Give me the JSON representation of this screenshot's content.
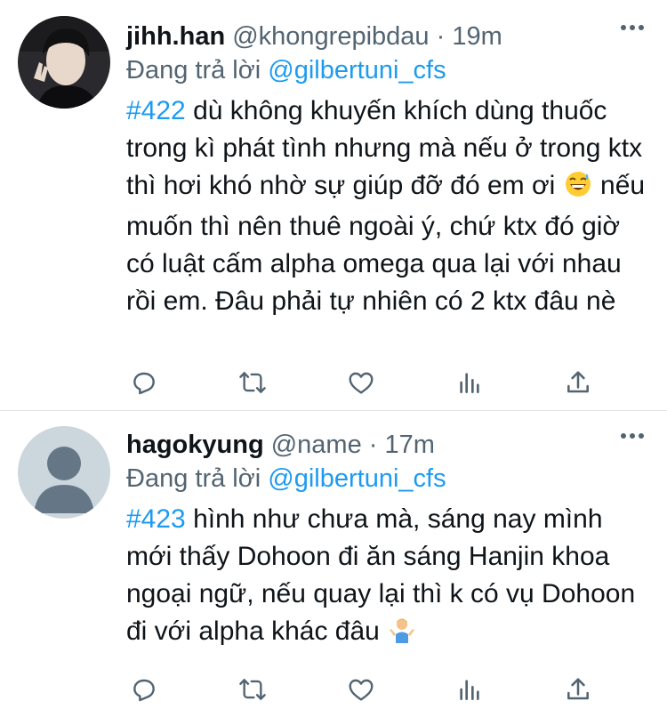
{
  "tweets": [
    {
      "display_name": "jihh.han",
      "handle": "@khongrepibdau",
      "time": "19m",
      "reply_prefix": "Đang trả lời",
      "reply_to": "@gilbertuni_cfs",
      "hashtag": "#422",
      "text_1": " dù không khuyến khích dùng thuốc trong kì phát tình nhưng mà nếu ở trong ktx thì hơi khó nhờ sự giúp đỡ đó em ơi",
      "emoji_1": "grinning-sweat-emoji",
      "text_2": "  nếu muốn thì nên thuê ngoài ý, chứ ktx đó giờ có luật cấm alpha omega qua lại với nhau rồi em. Đâu phải tự nhiên có 2 ktx đâu nè",
      "avatar": "photo-avatar"
    },
    {
      "display_name": "hagokyung",
      "handle": "@name",
      "time": "17m",
      "reply_prefix": "Đang trả lời",
      "reply_to": "@gilbertuni_cfs",
      "hashtag": "#423",
      "text_1": " hình như chưa mà, sáng nay mình mới thấy Dohoon đi ăn sáng Hanjin khoa ngoại ngữ, nếu quay lại thì k có vụ Dohoon đi với alpha khác đâu ",
      "emoji_1": "person-shrugging-emoji",
      "avatar": "default-avatar"
    }
  ],
  "separator": "·",
  "colors": {
    "accent": "#1d9bf0",
    "secondary_text": "#536471",
    "primary_text": "#0f1419",
    "divider": "#dfe3e6"
  },
  "action_icons": [
    "reply-icon",
    "retweet-icon",
    "like-icon",
    "analytics-icon",
    "share-icon"
  ]
}
